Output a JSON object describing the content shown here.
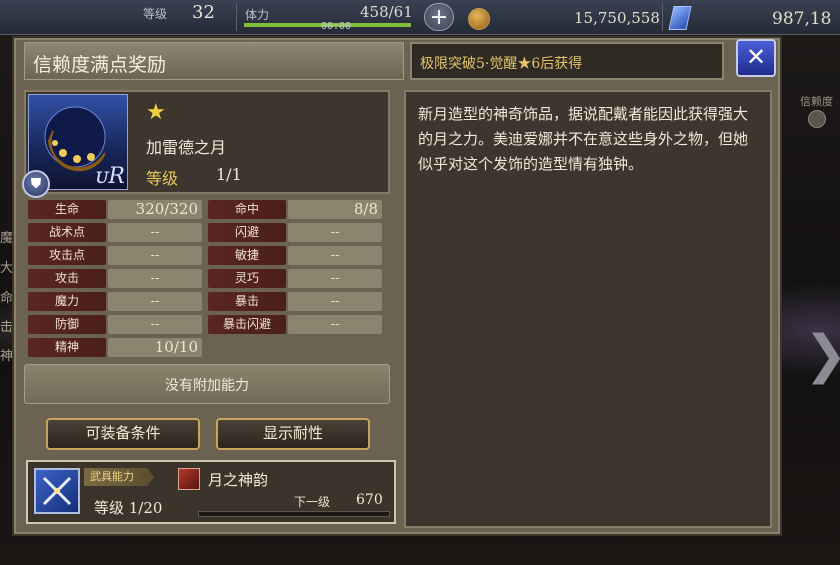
{
  "topbar": {
    "level_label": "等级",
    "level_value": "32",
    "stamina_label": "体力",
    "stamina_value": "458/61",
    "stamina_fraction": 0.95,
    "stamina_timer": "00:00",
    "add_label": "+",
    "gil_value": "15,750,558",
    "gem_value": "987,18"
  },
  "panel": {
    "title": "信赖度满点奖励",
    "condition": "极限突破5·觉醒★6后获得",
    "close_label": "✕"
  },
  "item": {
    "name": "加雷德之月",
    "stars": "★",
    "level_label": "等级",
    "level_value": "1/1",
    "rarity": "UR",
    "rarity_display": "ᴜR",
    "type_badge": "⛊"
  },
  "stats": {
    "left": [
      {
        "label": "生命",
        "value": "320/320"
      },
      {
        "label": "战术点",
        "value": "--"
      },
      {
        "label": "攻击点",
        "value": "--"
      },
      {
        "label": "攻击",
        "value": "--"
      },
      {
        "label": "魔力",
        "value": "--"
      },
      {
        "label": "防御",
        "value": "--"
      },
      {
        "label": "精神",
        "value": "10/10"
      }
    ],
    "right": [
      {
        "label": "命中",
        "value": "8/8"
      },
      {
        "label": "闪避",
        "value": "--"
      },
      {
        "label": "敏捷",
        "value": "--"
      },
      {
        "label": "灵巧",
        "value": "--"
      },
      {
        "label": "暴击",
        "value": "--"
      },
      {
        "label": "暴击闪避",
        "value": "--"
      }
    ]
  },
  "no_ability": "没有附加能力",
  "buttons": {
    "equip_conditions": "可装备条件",
    "show_resistance": "显示耐性"
  },
  "ability": {
    "tag": "武具能力",
    "name": "月之神韵",
    "level": "等级 1/20",
    "next_label": "下一级",
    "next_value": "670",
    "progress_fraction": 0.0
  },
  "description": "新月造型的神奇饰品，据说配戴者能因此获得强大的月之力。美迪爱娜并不在意这些身外之物，但她似乎对这个发饰的造型情有独钟。",
  "background": {
    "right_label": "信赖度",
    "next_arrow": "❯",
    "left_glyphs": [
      "魔",
      "大",
      "命",
      "击",
      "神"
    ]
  },
  "colors": {
    "accent_gold": "#e2c46a",
    "stat_label_bg": "#5a2620",
    "close_button": "#2f44c0"
  }
}
